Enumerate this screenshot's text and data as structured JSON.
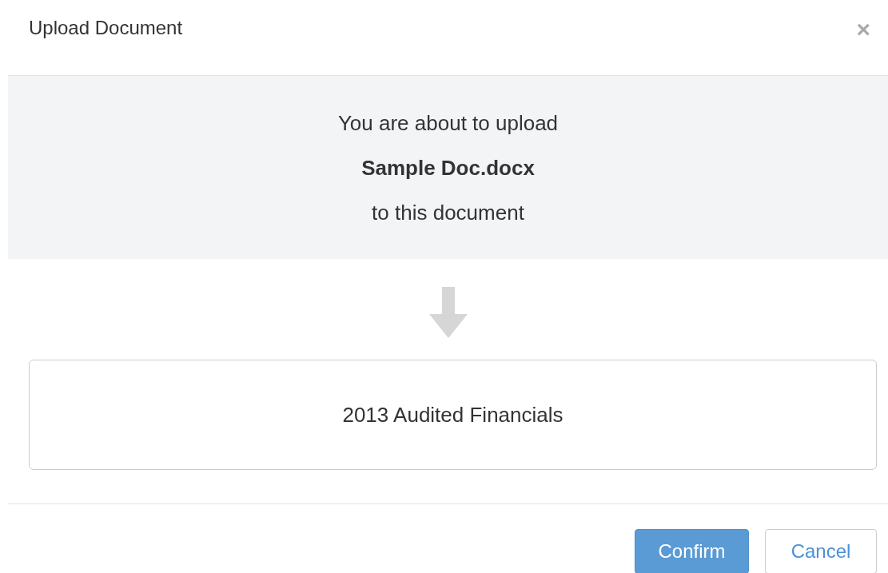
{
  "dialog": {
    "title": "Upload Document",
    "close": "×",
    "message": "You are about to upload\n**Sample Doc.docx**\nto this document",
    "target": "2013 Audited Financials",
    "buttons": [
      {
        "label": "Confirm",
        "kind": "primary"
      },
      {
        "label": "Cancel",
        "kind": "secondary"
      }
    ]
  }
}
